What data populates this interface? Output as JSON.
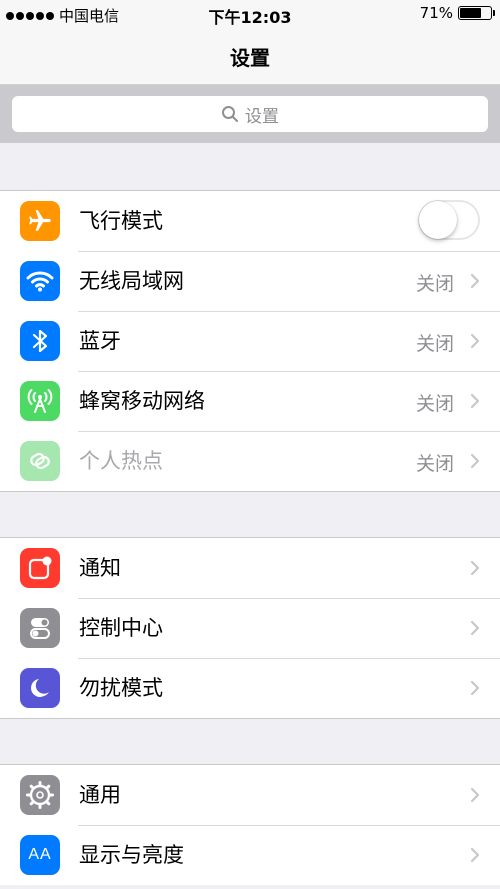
{
  "status_bar": {
    "carrier": "中国电信",
    "time": "下午12:03",
    "battery": "71%",
    "battery_level": 0.71
  },
  "nav": {
    "title": "设置"
  },
  "search": {
    "placeholder": "设置"
  },
  "group1": [
    {
      "label": "飞行模式",
      "icon": "airplane-icon",
      "color": "#ff9500",
      "control": "toggle",
      "on": false
    },
    {
      "label": "无线局域网",
      "icon": "wifi-icon",
      "color": "#007aff",
      "value": "关闭"
    },
    {
      "label": "蓝牙",
      "icon": "bluetooth-icon",
      "color": "#007aff",
      "value": "关闭"
    },
    {
      "label": "蜂窝移动网络",
      "icon": "cellular-antenna-icon",
      "color": "#4cd964",
      "value": "关闭"
    },
    {
      "label": "个人热点",
      "icon": "hotspot-chain-icon",
      "color": "#a6e7b0",
      "value": "关闭",
      "disabled": true
    }
  ],
  "group2": [
    {
      "label": "通知",
      "icon": "notifications-icon",
      "color": "#ff3b30"
    },
    {
      "label": "控制中心",
      "icon": "control-center-icon",
      "color": "#8e8e93"
    },
    {
      "label": "勿扰模式",
      "icon": "moon-icon",
      "color": "#5856d6"
    }
  ],
  "group3": [
    {
      "label": "通用",
      "icon": "gear-icon",
      "color": "#8e8e93"
    },
    {
      "label": "显示与亮度",
      "icon": "display-brightness-icon",
      "color": "#007aff",
      "icon_text": "AA"
    }
  ]
}
